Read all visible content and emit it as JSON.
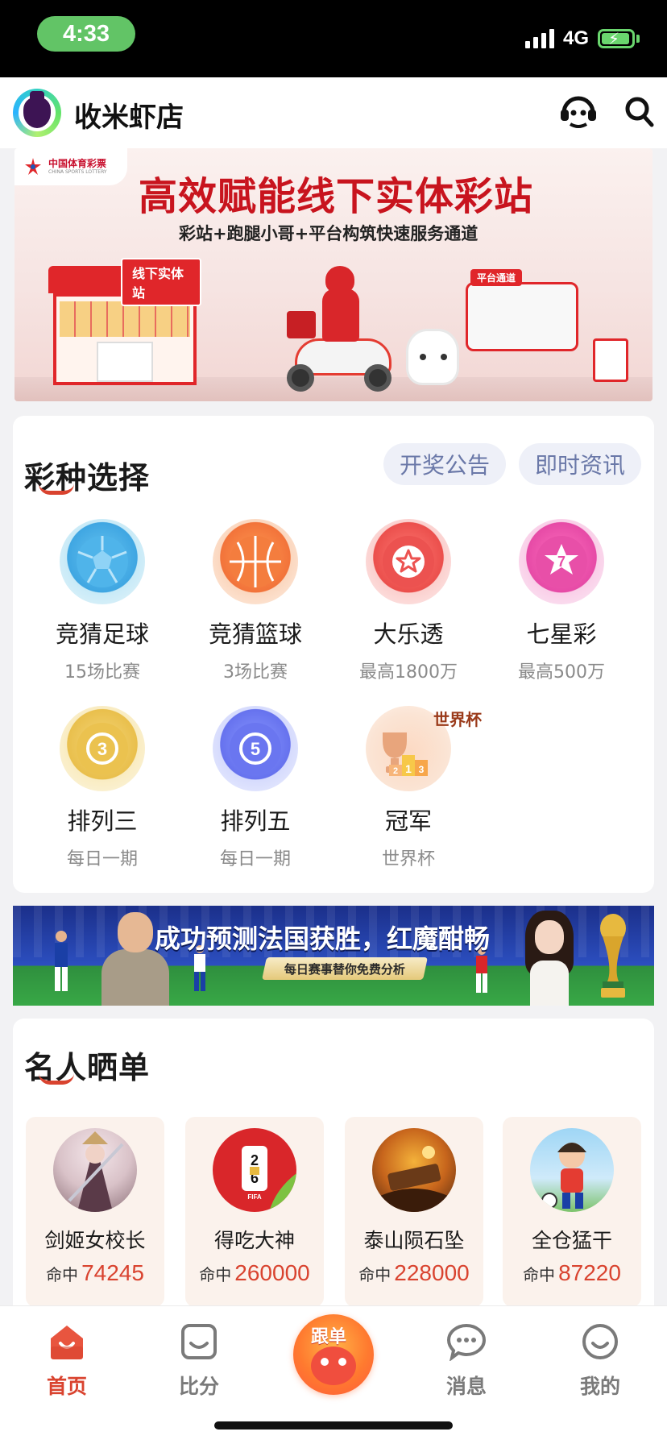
{
  "status_bar": {
    "time": "4:33",
    "network": "4G",
    "battery_icon": "battery-charging-icon",
    "colors": {
      "time_pill": "#62c466",
      "battery": "#6ad66e"
    }
  },
  "header": {
    "shop_name": "收米虾店",
    "logo_icon": "premier-league-lion-logo",
    "right_icons": [
      "customer-service-icon",
      "search-icon"
    ]
  },
  "banner_top": {
    "brand_text": "中国体育彩票",
    "brand_sub": "CHINA SPORTS LOTTERY",
    "title": "高效赋能线下实体彩站",
    "subtitle": "彩站+跑腿小哥+平台构筑快速服务通道",
    "shop_tag": "线下实体站",
    "platform_tag": "平台通道"
  },
  "lottery_section": {
    "title": "彩种选择",
    "pills": [
      "开奖公告",
      "即时资讯"
    ],
    "games": [
      {
        "name": "竞猜足球",
        "sub": "15场比赛",
        "icon": "football-icon"
      },
      {
        "name": "竞猜篮球",
        "sub": "3场比赛",
        "icon": "basketball-icon"
      },
      {
        "name": "大乐透",
        "sub": "最高1800万",
        "icon": "star-ball-icon"
      },
      {
        "name": "七星彩",
        "sub": "最高500万",
        "icon": "seven-star-icon"
      },
      {
        "name": "排列三",
        "sub": "每日一期",
        "icon": "number-3-ball-icon"
      },
      {
        "name": "排列五",
        "sub": "每日一期",
        "icon": "number-5-ball-icon"
      },
      {
        "name": "冠军",
        "sub": "世界杯",
        "icon": "world-cup-trophy-icon",
        "badge": "世界杯"
      }
    ]
  },
  "banner_ad": {
    "title": "成功预测法国获胜，红魔酣畅",
    "subtitle": "每日赛事替你免费分析"
  },
  "celebrity_section": {
    "title": "名人晒单",
    "hit_label": "命中",
    "items": [
      {
        "name": "剑姬女校长",
        "hits": "74245",
        "avatar": "game-character-avatar"
      },
      {
        "name": "得吃大神",
        "hits": "260000",
        "avatar": "fifa-26-logo-avatar"
      },
      {
        "name": "泰山陨石坠",
        "hits": "228000",
        "avatar": "fiery-artwork-avatar"
      },
      {
        "name": "全仓猛干",
        "hits": "87220",
        "avatar": "cartoon-soccer-player-avatar"
      }
    ]
  },
  "tabbar": {
    "items": [
      {
        "label": "首页",
        "icon": "home-icon",
        "active": true
      },
      {
        "label": "比分",
        "icon": "score-bag-icon",
        "active": false
      },
      {
        "label": "跟单",
        "icon": "follow-mascot-icon",
        "active": false
      },
      {
        "label": "消息",
        "icon": "message-icon",
        "active": false
      },
      {
        "label": "我的",
        "icon": "smiley-profile-icon",
        "active": false
      }
    ],
    "colors": {
      "active": "#d9432f",
      "inactive": "#7a7a7a"
    }
  }
}
